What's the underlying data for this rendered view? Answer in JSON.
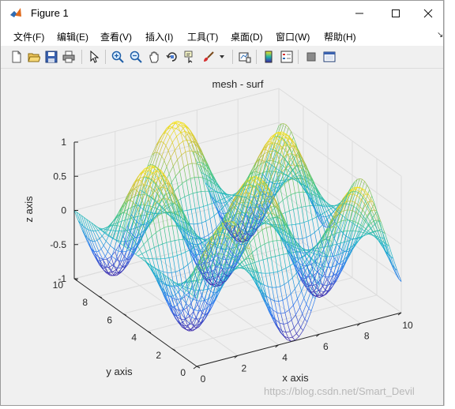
{
  "window": {
    "title": "Figure 1"
  },
  "menu": [
    "文件(F)",
    "编辑(E)",
    "查看(V)",
    "插入(I)",
    "工具(T)",
    "桌面(D)",
    "窗口(W)",
    "帮助(H)"
  ],
  "toolbar": [
    "new-figure-icon",
    "open-file-icon",
    "save-icon",
    "print-icon",
    "pointer-icon",
    "zoom-in-icon",
    "zoom-out-icon",
    "pan-icon",
    "rotate-3d-icon",
    "data-cursor-icon",
    "brush-icon",
    "link-plot-icon",
    "colorbar-icon",
    "legend-icon",
    "hide-plot-tools-icon",
    "show-plot-tools-icon"
  ],
  "chart_data": {
    "type": "surface-mesh",
    "title": "mesh - surf",
    "xlabel": "x axis",
    "ylabel": "y axis",
    "zlabel": "z axis",
    "function": "z = sin(x)·cos(y)",
    "xlim": [
      0,
      10
    ],
    "ylim": [
      0,
      10
    ],
    "zlim": [
      -1,
      1
    ],
    "xticks": [
      "0",
      "2",
      "4",
      "6",
      "8",
      "10"
    ],
    "yticks": [
      "0",
      "2",
      "4",
      "6",
      "8",
      "10"
    ],
    "zticks": [
      "-1",
      "-0.5",
      "0",
      "0.5",
      "1"
    ],
    "colormap": "parula",
    "grid": true
  },
  "watermark": "https://blog.csdn.net/Smart_Devil"
}
